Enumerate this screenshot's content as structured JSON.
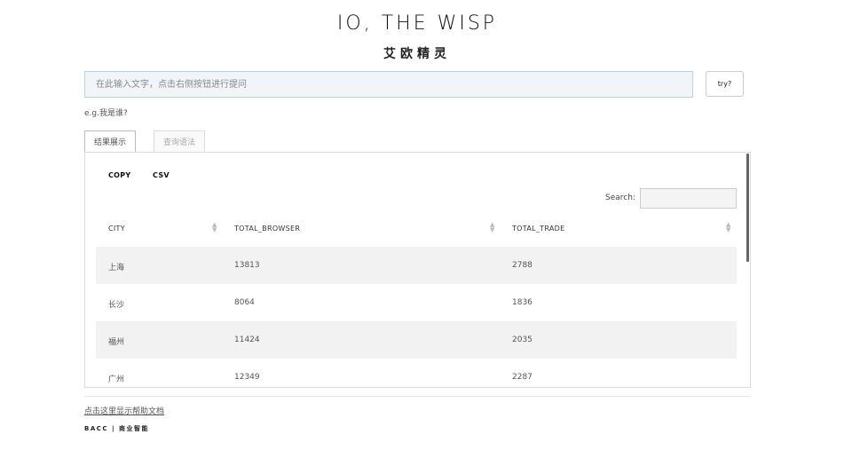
{
  "header": {
    "title": "IO, THE WISP",
    "subtitle": "艾欧精灵"
  },
  "query": {
    "placeholder": "在此输入文字，点击右侧按钮进行提问",
    "value": "",
    "submit_label": "try?",
    "example": "e.g.我是谁?"
  },
  "tabs": [
    {
      "label": "结果展示",
      "active": true
    },
    {
      "label": "查询语法",
      "active": false
    }
  ],
  "results": {
    "copy_label": "COPY",
    "csv_label": "CSV",
    "search_label": "Search:",
    "columns": [
      "CITY",
      "TOTAL_BROWSER",
      "TOTAL_TRADE"
    ],
    "rows": [
      [
        "上海",
        "13813",
        "2788"
      ],
      [
        "长沙",
        "8064",
        "1836"
      ],
      [
        "福州",
        "11424",
        "2035"
      ],
      [
        "广州",
        "12349",
        "2287"
      ]
    ]
  },
  "footer": {
    "help_link": "点击这里显示帮助文档",
    "brand": "BACC | 商业智能"
  }
}
